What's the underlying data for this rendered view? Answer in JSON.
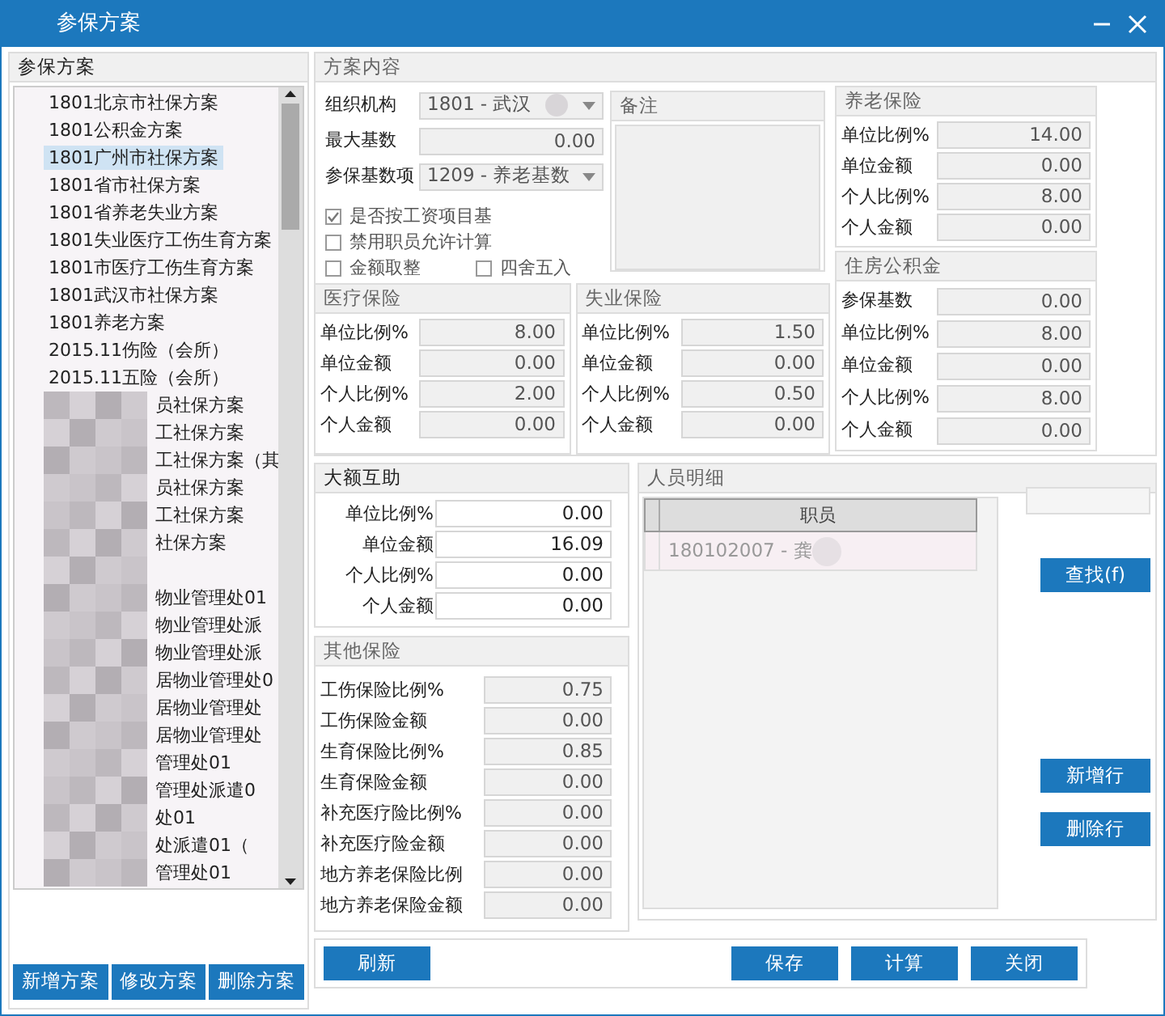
{
  "window": {
    "title": "参保方案"
  },
  "scheme_list": {
    "title": "参保方案",
    "items": [
      {
        "label": "1801北京市社保方案",
        "selected": false,
        "redacted": false
      },
      {
        "label": "1801公积金方案",
        "selected": false,
        "redacted": false
      },
      {
        "label": "1801广州市社保方案",
        "selected": true,
        "redacted": false
      },
      {
        "label": "1801省市社保方案",
        "selected": false,
        "redacted": false
      },
      {
        "label": "1801省养老失业方案",
        "selected": false,
        "redacted": false
      },
      {
        "label": "1801失业医疗工伤生育方案",
        "selected": false,
        "redacted": false
      },
      {
        "label": "1801市医疗工伤生育方案",
        "selected": false,
        "redacted": false
      },
      {
        "label": "1801武汉市社保方案",
        "selected": false,
        "redacted": false
      },
      {
        "label": "1801养老方案",
        "selected": false,
        "redacted": false
      },
      {
        "label": "2015.11伤险（会所）",
        "selected": false,
        "redacted": false
      },
      {
        "label": "2015.11五险（会所）",
        "selected": false,
        "redacted": false
      },
      {
        "label": "员社保方案",
        "selected": false,
        "redacted": true
      },
      {
        "label": "工社保方案",
        "selected": false,
        "redacted": true
      },
      {
        "label": "工社保方案（其",
        "selected": false,
        "redacted": true
      },
      {
        "label": "员社保方案",
        "selected": false,
        "redacted": true
      },
      {
        "label": "工社保方案",
        "selected": false,
        "redacted": true
      },
      {
        "label": "社保方案",
        "selected": false,
        "redacted": true
      },
      {
        "selected": false,
        "redacted": true
      },
      {
        "label": "物业管理处01",
        "selected": false,
        "redacted": true
      },
      {
        "label": "物业管理处派",
        "selected": false,
        "redacted": true
      },
      {
        "label": "物业管理处派",
        "selected": false,
        "redacted": true
      },
      {
        "label": "居物业管理处0",
        "selected": false,
        "redacted": true
      },
      {
        "label": "居物业管理处",
        "selected": false,
        "redacted": true
      },
      {
        "label": "居物业管理处",
        "selected": false,
        "redacted": true
      },
      {
        "label": "管理处01",
        "selected": false,
        "redacted": true
      },
      {
        "label": "管理处派遣0",
        "selected": false,
        "redacted": true
      },
      {
        "label": "处01",
        "selected": false,
        "redacted": true
      },
      {
        "label": "处派遣01（",
        "selected": false,
        "redacted": true
      },
      {
        "label": "管理处01",
        "selected": false,
        "redacted": true
      }
    ],
    "buttons": [
      "新增方案",
      "修改方案",
      "删除方案"
    ]
  },
  "scheme_content": {
    "title": "方案内容",
    "org": {
      "label": "组织机构",
      "value": "1801 - 武汉"
    },
    "max_base": {
      "label": "最大基数",
      "value": "0.00"
    },
    "base_item": {
      "label": "参保基数项",
      "value": "1209 - 养老基数"
    },
    "checkboxes": [
      {
        "label": "是否按工资项目基",
        "checked": true
      },
      {
        "label": "禁用职员允许计算",
        "checked": false
      },
      {
        "label": "金额取整",
        "checked": false
      },
      {
        "label": "四舍五入",
        "checked": false
      }
    ],
    "notes": {
      "title": "备注"
    }
  },
  "medical": {
    "title": "医疗保险",
    "fields": [
      {
        "label": "单位比例%",
        "value": "8.00",
        "editable": false
      },
      {
        "label": "单位金额",
        "value": "0.00",
        "editable": false
      },
      {
        "label": "个人比例%",
        "value": "2.00",
        "editable": false
      },
      {
        "label": "个人金额",
        "value": "0.00",
        "editable": false
      }
    ]
  },
  "unemployment": {
    "title": "失业保险",
    "fields": [
      {
        "label": "单位比例%",
        "value": "1.50",
        "editable": false
      },
      {
        "label": "单位金额",
        "value": "0.00",
        "editable": false
      },
      {
        "label": "个人比例%",
        "value": "0.50",
        "editable": false
      },
      {
        "label": "个人金额",
        "value": "0.00",
        "editable": false
      }
    ]
  },
  "pension": {
    "title": "养老保险",
    "fields": [
      {
        "label": "单位比例%",
        "value": "14.00",
        "editable": false
      },
      {
        "label": "单位金额",
        "value": "0.00",
        "editable": false
      },
      {
        "label": "个人比例%",
        "value": "8.00",
        "editable": false
      },
      {
        "label": "个人金额",
        "value": "0.00",
        "editable": false
      }
    ]
  },
  "housing_fund": {
    "title": "住房公积金",
    "fields": [
      {
        "label": "参保基数",
        "value": "0.00",
        "editable": false
      },
      {
        "label": "单位比例%",
        "value": "8.00",
        "editable": false
      },
      {
        "label": "单位金额",
        "value": "0.00",
        "editable": false
      },
      {
        "label": "个人比例%",
        "value": "8.00",
        "editable": false
      },
      {
        "label": "个人金额",
        "value": "0.00",
        "editable": false
      }
    ]
  },
  "major_assistance": {
    "title": "大额互助",
    "fields": [
      {
        "label": "单位比例%",
        "value": "0.00",
        "editable": true
      },
      {
        "label": "单位金额",
        "value": "16.09",
        "editable": true
      },
      {
        "label": "个人比例%",
        "value": "0.00",
        "editable": true
      },
      {
        "label": "个人金额",
        "value": "0.00",
        "editable": true
      }
    ]
  },
  "other_insurance": {
    "title": "其他保险",
    "fields": [
      {
        "label": "工伤保险比例%",
        "value": "0.75",
        "editable": false
      },
      {
        "label": "工伤保险金额",
        "value": "0.00",
        "editable": false
      },
      {
        "label": "生育保险比例%",
        "value": "0.85",
        "editable": false
      },
      {
        "label": "生育保险金额",
        "value": "0.00",
        "editable": false
      },
      {
        "label": "补充医疗险比例%",
        "value": "0.00",
        "editable": false
      },
      {
        "label": "补充医疗险金额",
        "value": "0.00",
        "editable": false
      },
      {
        "label": "地方养老保险比例",
        "value": "0.00",
        "editable": false
      },
      {
        "label": "地方养老保险金额",
        "value": "0.00",
        "editable": false
      }
    ]
  },
  "staff_detail": {
    "title": "人员明细",
    "columns": [
      "职员"
    ],
    "rows": [
      {
        "cells": [
          "180102007 - 龚"
        ]
      }
    ],
    "buttons": [
      "查找(f)",
      "新增行",
      "删除行"
    ]
  },
  "footer_buttons": [
    "刷新",
    "保存",
    "计算",
    "关闭"
  ]
}
